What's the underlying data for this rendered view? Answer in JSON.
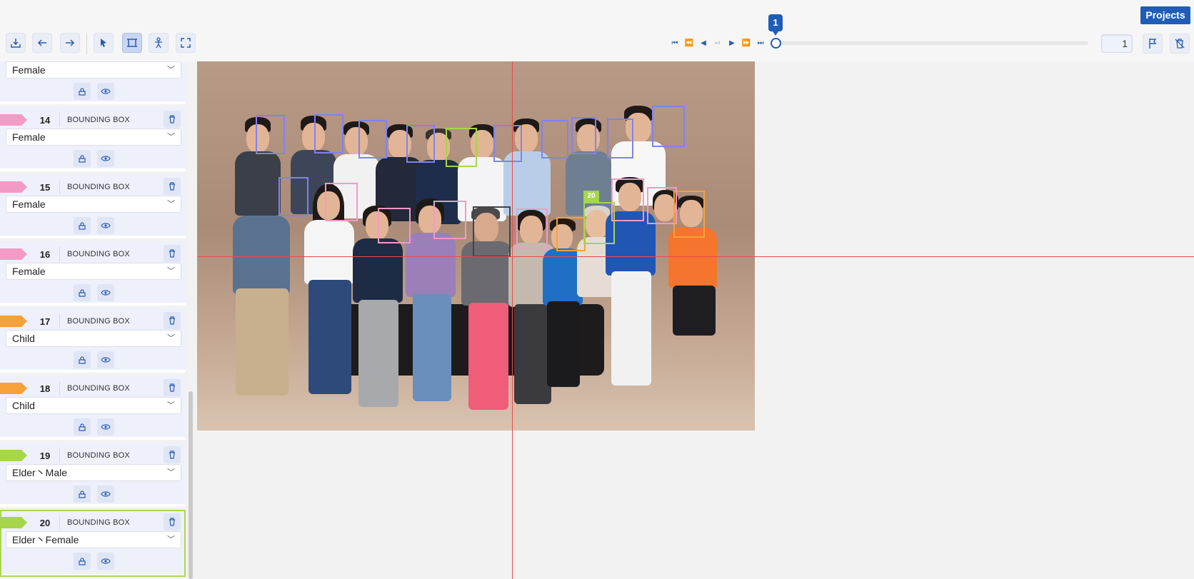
{
  "toolbar": {
    "buttons": [
      {
        "name": "save-icon"
      },
      {
        "name": "undo-icon"
      },
      {
        "name": "redo-icon"
      },
      {
        "name": "select-tool-icon"
      },
      {
        "name": "bounding-box-tool-icon"
      },
      {
        "name": "skeleton-tool-icon"
      },
      {
        "name": "fit-screen-icon"
      }
    ],
    "playback": [
      "first-frame-icon",
      "fast-backward-icon",
      "previous-frame-icon",
      "play-icon",
      "next-frame-icon",
      "fast-forward-icon",
      "last-frame-icon"
    ],
    "timeline_marker": "1",
    "frame_value": "1",
    "projects_label": "Projects",
    "flag_icon": "flag-icon",
    "clear_icon": "delete-frame-icon"
  },
  "panel": {
    "annotations": [
      {
        "id": "",
        "type": "",
        "label": "Female",
        "color": "#f39ac6",
        "partial": true
      },
      {
        "id": "14",
        "type": "BOUNDING BOX",
        "label": "Female",
        "color": "#f39ac6"
      },
      {
        "id": "15",
        "type": "BOUNDING BOX",
        "label": "Female",
        "color": "#f39ac6"
      },
      {
        "id": "16",
        "type": "BOUNDING BOX",
        "label": "Female",
        "color": "#f39ac6"
      },
      {
        "id": "17",
        "type": "BOUNDING BOX",
        "label": "Child",
        "color": "#f7a13a"
      },
      {
        "id": "18",
        "type": "BOUNDING BOX",
        "label": "Child",
        "color": "#f7a13a"
      },
      {
        "id": "19",
        "type": "BOUNDING BOX",
        "label": "Elder丶Male",
        "color": "#a6d64a"
      },
      {
        "id": "20",
        "type": "BOUNDING BOX",
        "label": "Elder丶Female",
        "color": "#a6d64a",
        "selected": true
      }
    ]
  },
  "canvas": {
    "selected_box_label": "20"
  }
}
